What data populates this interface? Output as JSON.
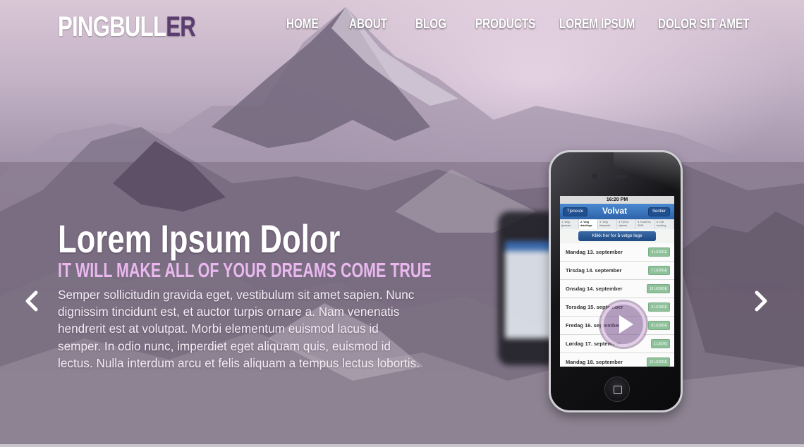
{
  "brand": {
    "logo_main": "PINGBULL",
    "logo_accent": "ER"
  },
  "nav": {
    "items": [
      {
        "label": "HOME"
      },
      {
        "label": "ABOUT"
      },
      {
        "label": "BLOG"
      },
      {
        "label": "PRODUCTS"
      },
      {
        "label": "LOREM IPSUM"
      },
      {
        "label": "DOLOR SIT AMET"
      }
    ]
  },
  "slide": {
    "title": "Lorem Ipsum Dolor",
    "subtitle": "IT WILL MAKE ALL OF YOUR DREAMS COME TRUE",
    "body": "Semper sollicitudin gravida eget, vestibulum sit amet sapien. Nunc dignissim tincidunt est, et auctor turpis ornare a. Nam venenatis hendrerit est at volutpat. Morbi elementum euismod lacus id semper. In odio nunc, imperdiet eget aliquam quis, euismod id lectus. Nulla interdum arcu et felis aliquam a tempus lectus lobortis."
  },
  "slider": {
    "prev_icon": "chevron-left-icon",
    "next_icon": "chevron-right-icon"
  },
  "phone_screen": {
    "time": "16:20 PM",
    "left_button": "Tjeneste",
    "brand": "Volvat",
    "right_button": "Sentier",
    "steps": [
      "1. Velg tjeneste",
      "2. Velg dato/lege",
      "3. Velg tidspunkt",
      "4. Fyll ut skjema",
      "5. Kode fra SMS",
      "6. Ditt booking"
    ],
    "picker_label": "Klikk her for å velge lege",
    "rows": [
      {
        "date": "Mandag 13. september",
        "badge": "4 LEDIGE"
      },
      {
        "date": "Tirsdag 14. september",
        "badge": "7 LEDIGE"
      },
      {
        "date": "Onsdag 14. september",
        "badge": "13 LEDIGE"
      },
      {
        "date": "Torsdag 15. september",
        "badge": "9 LEDIGE"
      },
      {
        "date": "Fredag 16. september",
        "badge": "8 LEDIGE"
      },
      {
        "date": "Lørdag 17. september",
        "badge": "1 LEDIG"
      },
      {
        "date": "Mandag 18. september",
        "badge": "12 LEDIGE"
      }
    ]
  },
  "colors": {
    "accent_purple": "#5b3d6f",
    "subtitle_pink": "#e9b8ef"
  }
}
